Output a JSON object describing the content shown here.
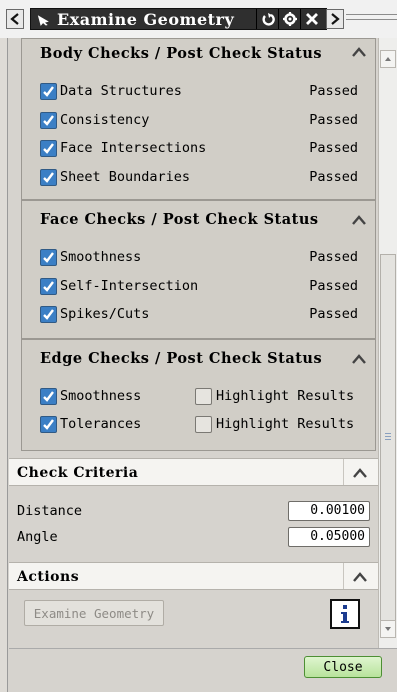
{
  "window": {
    "title": "Examine Geometry",
    "title_icon": "selection-arrow-icon",
    "buttons": [
      "reset-icon",
      "gear-icon",
      "close-icon"
    ],
    "nav_left": "chevron-left-icon",
    "nav_right": "chevron-right-icon"
  },
  "body_checks": {
    "title": "Body Checks / Post Check Status",
    "items": [
      {
        "label": "Data Structures",
        "checked": true,
        "status": "Passed"
      },
      {
        "label": "Consistency",
        "checked": true,
        "status": "Passed"
      },
      {
        "label": "Face Intersections",
        "checked": true,
        "status": "Passed"
      },
      {
        "label": "Sheet Boundaries",
        "checked": true,
        "status": "Passed"
      }
    ]
  },
  "face_checks": {
    "title": "Face Checks / Post Check Status",
    "items": [
      {
        "label": "Smoothness",
        "checked": true,
        "status": "Passed"
      },
      {
        "label": "Self-Intersection",
        "checked": true,
        "status": "Passed"
      },
      {
        "label": "Spikes/Cuts",
        "checked": true,
        "status": "Passed"
      }
    ]
  },
  "edge_checks": {
    "title": "Edge Checks / Post Check Status",
    "items": [
      {
        "label": "Smoothness",
        "checked": true,
        "highlight_label": "Highlight Results",
        "highlight_checked": false
      },
      {
        "label": "Tolerances",
        "checked": true,
        "highlight_label": "Highlight Results",
        "highlight_checked": false
      }
    ]
  },
  "check_criteria": {
    "title": "Check Criteria",
    "fields": [
      {
        "label": "Distance",
        "value": "0.00100"
      },
      {
        "label": "Angle",
        "value": "0.05000"
      }
    ]
  },
  "actions": {
    "title": "Actions",
    "examine_button": "Examine Geometry",
    "info_icon": "info-icon"
  },
  "footer": {
    "close_label": "Close"
  },
  "colors": {
    "checkbox_checked": "#3b7fc5",
    "close_button": "#b8e39c",
    "title_bar": "#2f2f2f"
  }
}
